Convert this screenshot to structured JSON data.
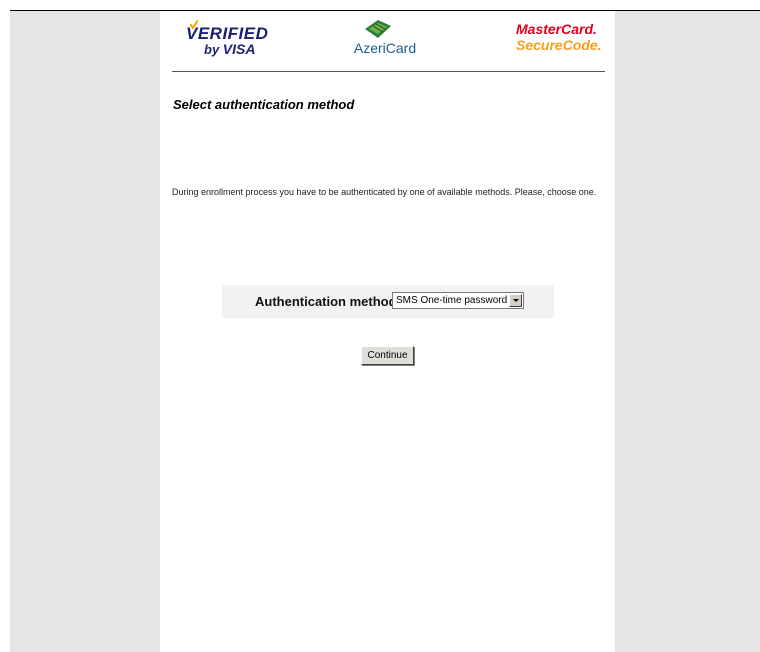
{
  "logos": {
    "visa": {
      "line1": "VERIFIED",
      "line2_by": "by",
      "line2_visa": "VISA"
    },
    "azericard": {
      "text": "AzeriCard"
    },
    "mastercard": {
      "line1": "MasterCard.",
      "line2": "SecureCode."
    }
  },
  "page": {
    "title": "Select authentication method",
    "intro": "During enrollment process you have to be authenticated by one of available methods. Please, choose one."
  },
  "form": {
    "method_label": "Authentication method:",
    "method_selected": "SMS One-time password",
    "continue_label": "Continue"
  },
  "colors": {
    "page_margin": "#e5e5e5",
    "visa_blue": "#1a1f71",
    "mastercard_red": "#e2001a",
    "mastercard_orange": "#f79e1b",
    "azericard_blue": "#1b5e8f",
    "form_box": "#f2f2f2"
  }
}
